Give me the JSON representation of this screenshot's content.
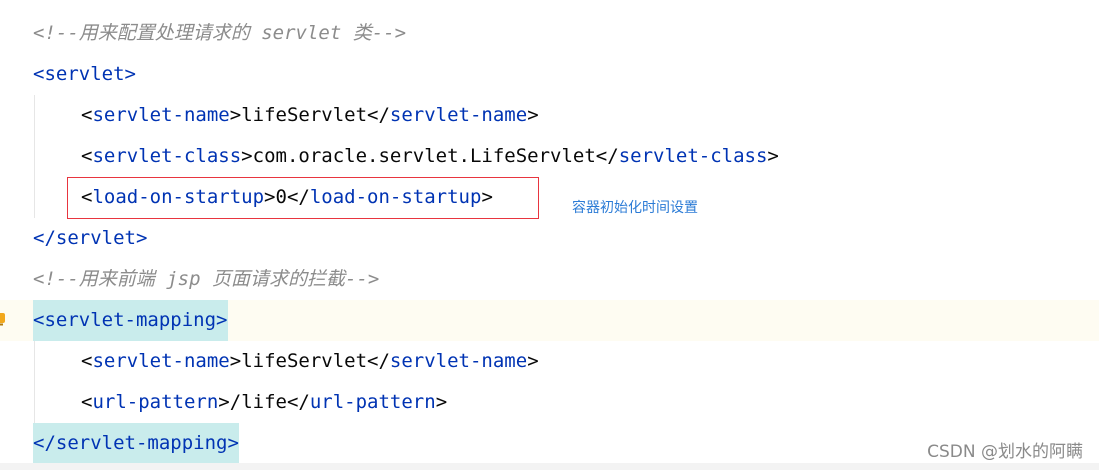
{
  "editor": {
    "lines": [
      {
        "comment": "<!--用来配置处理请求的 servlet 类-->"
      },
      {
        "open": "<",
        "tag": "servlet",
        "close": ">"
      },
      {
        "open": "<",
        "tag": "servlet-name",
        "close": ">",
        "text": "lifeServlet",
        "open2": "</",
        "tag2": "servlet-name",
        "close2": ">"
      },
      {
        "open": "<",
        "tag": "servlet-class",
        "close": ">",
        "text": "com.oracle.servlet.LifeServlet",
        "open2": "</",
        "tag2": "servlet-class",
        "close2": ">"
      },
      {
        "open": "<",
        "tag": "load-on-startup",
        "close": ">",
        "text": "0",
        "open2": "</",
        "tag2": "load-on-startup",
        "close2": ">"
      },
      {
        "open": "</",
        "tag": "servlet",
        "close": ">"
      },
      {
        "comment": "<!--用来前端 jsp 页面请求的拦截-->"
      },
      {
        "open": "<",
        "tag": "servlet-mapping",
        "close": ">"
      },
      {
        "open": "<",
        "tag": "servlet-name",
        "close": ">",
        "text": "lifeServlet",
        "open2": "</",
        "tag2": "servlet-name",
        "close2": ">"
      },
      {
        "open": "<",
        "tag": "url-pattern",
        "close": ">",
        "text": "/life",
        "open2": "</",
        "tag2": "url-pattern",
        "close2": ">"
      },
      {
        "open": "</",
        "tag": "servlet-mapping",
        "close": ">"
      }
    ]
  },
  "annotation": {
    "text": "容器初始化时间设置",
    "color": "#2b7bd6",
    "box_color": "#e8353f"
  },
  "watermark": "CSDN @划水的阿瞒",
  "colors": {
    "tag": "#0033b3",
    "comment": "#8c8c8c",
    "text": "#080808",
    "match_highlight": "#c9ecec",
    "current_line": "#fefcf2"
  },
  "gutter_icon": "intention-bulb-icon"
}
